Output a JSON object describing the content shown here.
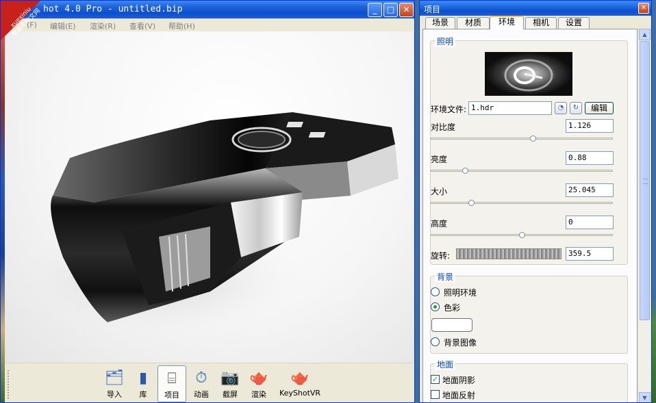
{
  "watermark": {
    "line1": "xuexiniu",
    "line2": "学犀牛中文网"
  },
  "main_window": {
    "title": "hot 4.0 Pro  - untitled.bip",
    "menu": [
      "(F)",
      "编辑(E)",
      "渲染(R)",
      "查看(V)",
      "帮助(H)"
    ],
    "toolbar": [
      {
        "label": "导入",
        "icon": "import-icon"
      },
      {
        "label": "库",
        "icon": "library-icon"
      },
      {
        "label": "项目",
        "icon": "project-icon"
      },
      {
        "label": "动画",
        "icon": "animation-icon"
      },
      {
        "label": "截屏",
        "icon": "screenshot-icon"
      },
      {
        "label": "渲染",
        "icon": "render-icon"
      },
      {
        "label": "KeyShotVR",
        "icon": "keyshotvr-icon"
      }
    ],
    "active_toolbar": "项目"
  },
  "project_panel": {
    "title": "项目",
    "tabs": [
      "场景",
      "材质",
      "环境",
      "相机",
      "设置"
    ],
    "active_tab": "环境",
    "lighting": {
      "title": "照明",
      "env_file_label": "环境文件:",
      "env_file_value": "1.hdr",
      "edit_label": "编辑",
      "contrast_label": "对比度",
      "contrast_value": "1.126",
      "brightness_label": "亮度",
      "brightness_value": "0.88",
      "size_label": "大小",
      "size_value": "25.045",
      "height_label": "高度",
      "height_value": "0",
      "rotation_label": "旋转:",
      "rotation_value": "359.5"
    },
    "background": {
      "title": "背景",
      "option_env": "照明环境",
      "option_color": "色彩",
      "option_image": "背景图像",
      "selected": "色彩",
      "color": "#ffffff"
    },
    "ground": {
      "title": "地面",
      "shadow_label": "地面阴影",
      "shadow_checked": true,
      "reflection_label": "地面反射",
      "reflection_checked": false
    }
  }
}
